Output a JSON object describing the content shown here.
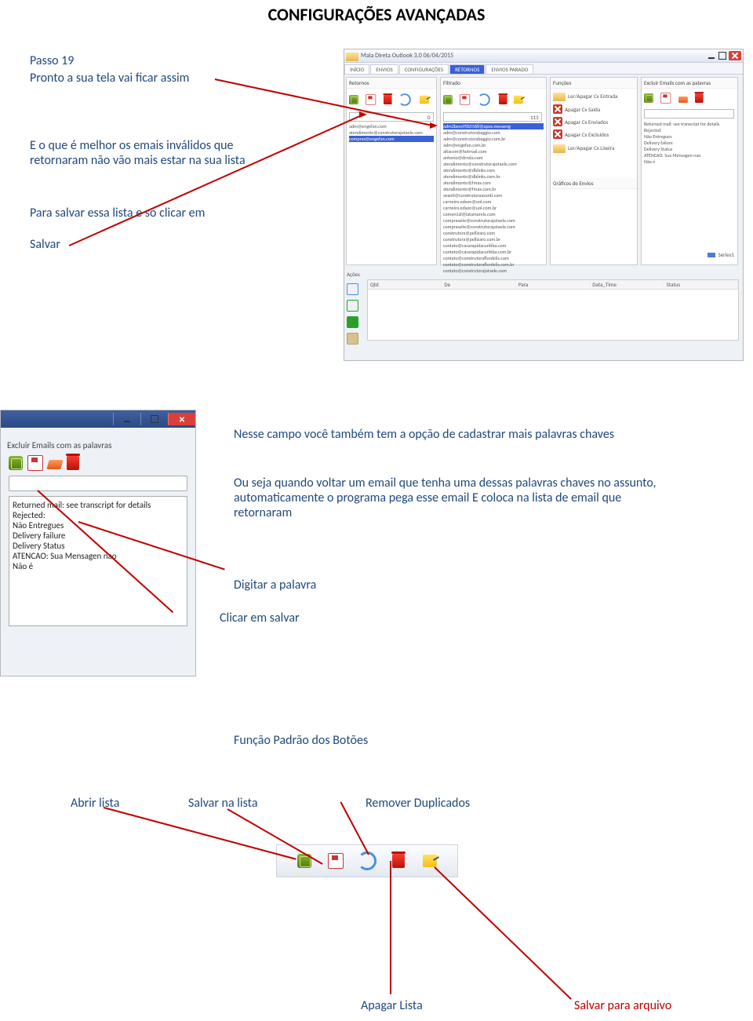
{
  "doc": {
    "title": "CONFIGURAÇÕES AVANÇADAS",
    "step": "Passo 19",
    "line1": "Pronto a sua tela vai ficar assim",
    "line2": "E o que é melhor os emais inválidos que retornaram não vão mais estar na sua lista",
    "line3": "Para salvar essa lista e so clicar em",
    "line4": "Salvar",
    "mid1": "Nesse campo você também tem a opção de cadastrar mais palavras chaves",
    "mid2": "Ou seja quando voltar um email que tenha uma dessas palavras chaves no assunto, automaticamente o programa pega esse email E coloca na lista de email que retornaram",
    "mid3": "Digitar a palavra",
    "mid4": "Clicar em salvar",
    "foot_title": "Função Padrão dos Botões",
    "btn_open": "Abrir lista",
    "btn_save": "Salvar na lista",
    "btn_dup": "Remover Duplicados",
    "btn_del": "Apagar Lista",
    "btn_savefile": "Salvar para arquivo"
  },
  "app": {
    "window_title": "Mala Direta Outlook 3.0 06/04/2015",
    "tabs": [
      "INÍCIO",
      "ENVIOS",
      "CONFIGURAÇÕES",
      "RETORNOS",
      "ENVIOS PARADO"
    ],
    "active_tab": "RETORNOS",
    "groups": {
      "retornos": "Retornos",
      "filtrado": "Filtrado",
      "funcoes": "Funções",
      "excluir": "Excluir Emails com as palavras",
      "graficos": "Gráficos de Envios",
      "acoes": "Ações"
    },
    "counts": {
      "filtrado": "0",
      "result": "113"
    },
    "funcoes": [
      "Ler/Apagar Cx Entrada",
      "Apagar Cx Saída",
      "Apagar Cx Enviados",
      "Apagar Cx Excluídos",
      "Ler/Apagar Cx Lixeira"
    ],
    "word_keys": [
      "Returned mail: see transcript for details",
      "Rejected:",
      "Não Entregues",
      "Delivery failure",
      "Delivery Status",
      "ATENCAO: Sua Mensagen nao",
      "Não é"
    ],
    "legend": "Series1",
    "table_headers": [
      "Qtd",
      "De",
      "Para",
      "Data_Time",
      "Status"
    ],
    "ret_emails": [
      "adm@engefan.com",
      "atendimento@construtorajotaele.com",
      "compras@engefan.com"
    ],
    "filt_emails": [
      "adm2bess95b5568@apos.messeng",
      "adm@construtorabaggio.com",
      "adm@construtorabaggio.com.br",
      "adm@engefan.com.br",
      "altacem@hotmail.com",
      "antonio@drnda.com",
      "atendimento@construtorajotaele.com",
      "atendimento@dblinks.com",
      "atendimento@dblinks.com.br",
      "atendimento@fmax.com",
      "atendimento@fmax.com.br",
      "avanti@construtoraavanti.com",
      "carneiro.edson@uol.com",
      "carneiro.edson@uol.com.br",
      "comercial@latamarelx.com",
      "comprassite@construtorajotaele.com",
      "comprassite@construtorajotaele.com",
      "construtora@pellizaro.com",
      "construtora@pellizaro.com.br",
      "contato@casarapidacuritiba.com",
      "contato@casarapidacuritiba.com.br",
      "contato@construtoraflordelis.com",
      "contato@construtoraflordelis.com.br",
      "contato@construtorajotaele.com"
    ]
  },
  "panel": {
    "group": "Excluir Emails com as palavras",
    "words": [
      "Returned mail: see transcript for details",
      "Rejected:",
      "Não Entregues",
      "Delivery failure",
      "Delivery Status",
      "ATENCAO: Sua Mensagen nao",
      "Não é"
    ]
  }
}
